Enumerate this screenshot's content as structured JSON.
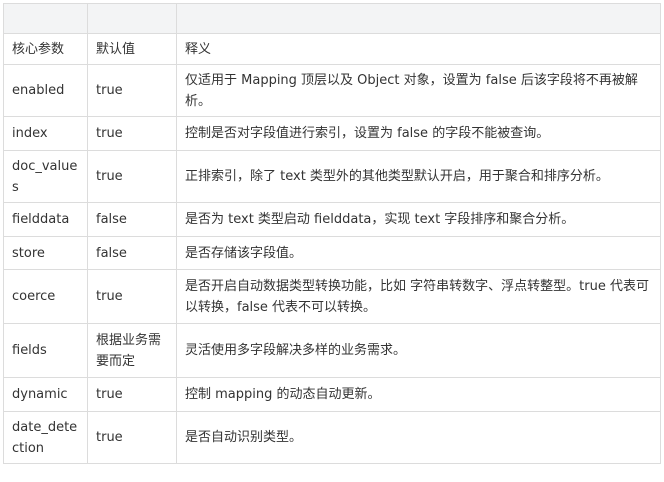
{
  "table": {
    "headers": [
      "核心参数",
      "默认值",
      "释义"
    ],
    "rows": [
      {
        "param": "enabled",
        "default": "true",
        "desc": "仅适用于 Mapping 顶层以及 Object 对象，设置为 false 后该字段将不再被解析。"
      },
      {
        "param": "index",
        "default": "true",
        "desc": "控制是否对字段值进行索引，设置为 false 的字段不能被查询。"
      },
      {
        "param": "doc_values",
        "default": "true",
        "desc": "正排索引，除了 text 类型外的其他类型默认开启，用于聚合和排序分析。"
      },
      {
        "param": "fielddata",
        "default": "false",
        "desc": "是否为 text 类型启动 fielddata，实现 text 字段排序和聚合分析。"
      },
      {
        "param": "store",
        "default": "false",
        "desc": "是否存储该字段值。"
      },
      {
        "param": "coerce",
        "default": "true",
        "desc": "是否开启自动数据类型转换功能，比如 字符串转数字、浮点转整型。true 代表可以转换，false 代表不可以转换。"
      },
      {
        "param": "fields",
        "default": "根据业务需要而定",
        "desc": "灵活使用多字段解决多样的业务需求。"
      },
      {
        "param": "dynamic",
        "default": "true",
        "desc": "控制 mapping 的动态自动更新。"
      },
      {
        "param": "date_detection",
        "default": "true",
        "desc": "是否自动识别类型。"
      }
    ]
  }
}
